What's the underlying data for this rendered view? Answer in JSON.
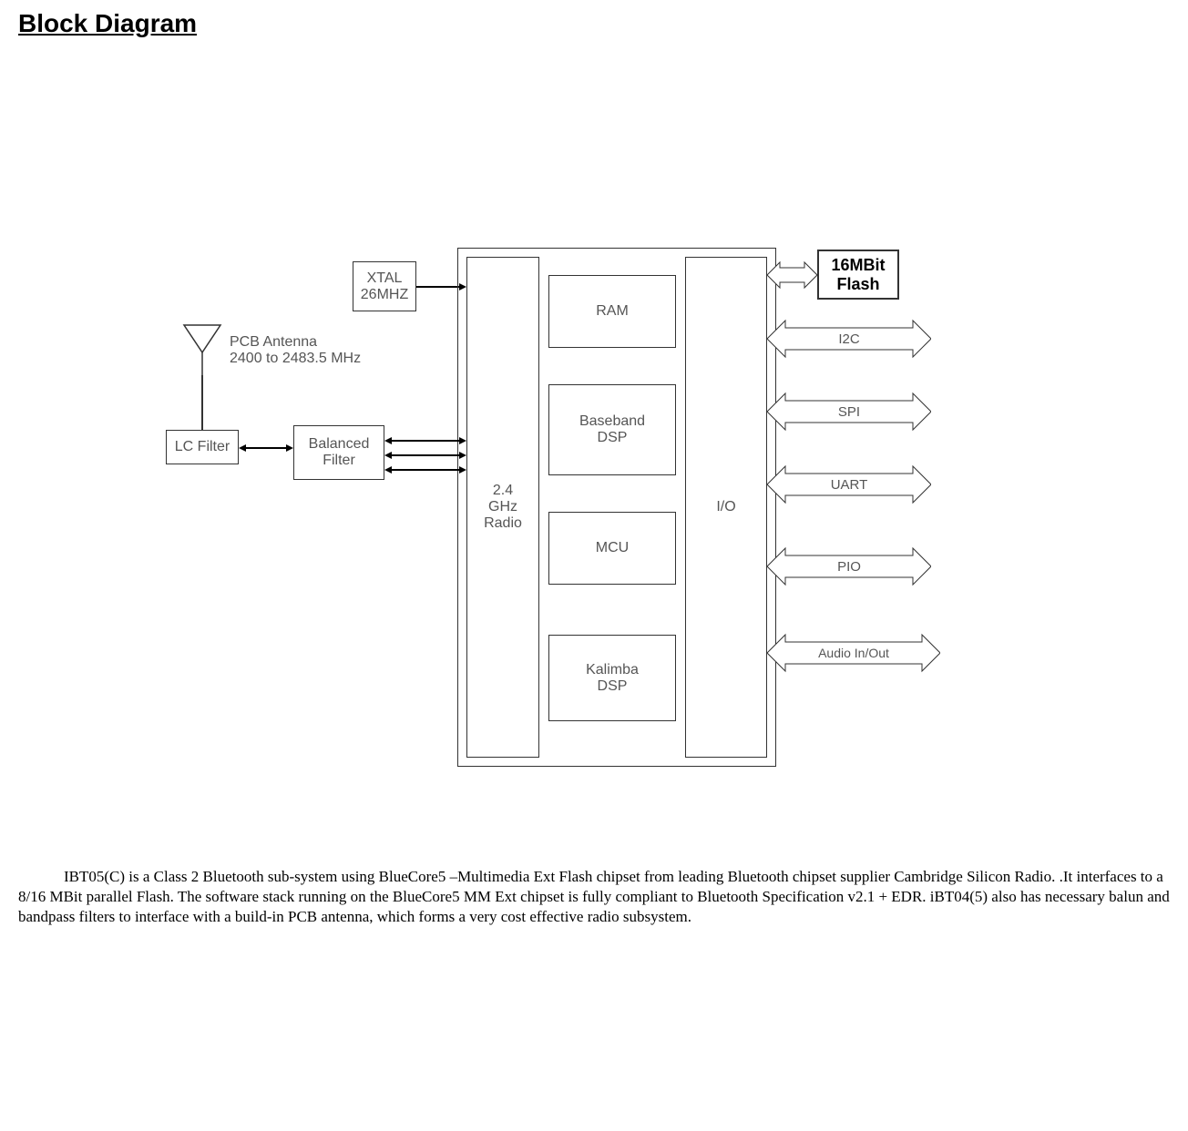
{
  "title": "Block Diagram",
  "antenna_label_1": "PCB Antenna",
  "antenna_label_2": "2400 to 2483.5 MHz",
  "lc_filter": "LC Filter",
  "balanced_filter": "Balanced\nFilter",
  "xtal": "XTAL\n26MHZ",
  "radio": "2.4\nGHz\nRadio",
  "ram": "RAM",
  "baseband": "Baseband\nDSP",
  "mcu": "MCU",
  "kalimba": "Kalimba\nDSP",
  "io": "I/O",
  "flash": "16MBit\nFlash",
  "i2c": "I2C",
  "spi": "SPI",
  "uart": "UART",
  "pio": "PIO",
  "audio": "Audio In/Out",
  "paragraph": "IBT05(C) is a Class 2 Bluetooth sub-system using BlueCore5 –Multimedia Ext Flash chipset from leading Bluetooth chipset supplier Cambridge Silicon Radio. .It interfaces to a 8/16 MBit parallel Flash.  The software stack running on the BlueCore5 MM Ext chipset is fully compliant to Bluetooth Specification v2.1 + EDR. iBT04(5) also has necessary balun and bandpass filters to interface with a build-in PCB antenna, which forms a very cost effective radio subsystem."
}
